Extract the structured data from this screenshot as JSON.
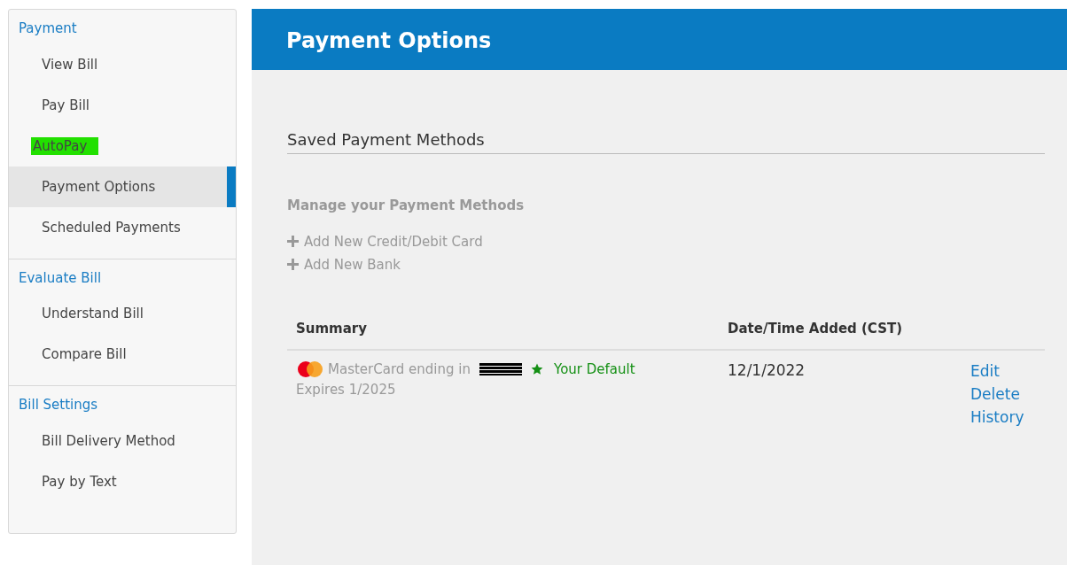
{
  "sidebar": {
    "sections": [
      {
        "heading": "Payment",
        "items": [
          {
            "label": "View Bill",
            "selected": false,
            "highlighted": false
          },
          {
            "label": "Pay Bill",
            "selected": false,
            "highlighted": false
          },
          {
            "label": "AutoPay",
            "selected": false,
            "highlighted": true
          },
          {
            "label": "Payment Options",
            "selected": true,
            "highlighted": false
          },
          {
            "label": "Scheduled Payments",
            "selected": false,
            "highlighted": false
          }
        ]
      },
      {
        "heading": "Evaluate Bill",
        "items": [
          {
            "label": "Understand Bill",
            "selected": false,
            "highlighted": false
          },
          {
            "label": "Compare Bill",
            "selected": false,
            "highlighted": false
          }
        ]
      },
      {
        "heading": "Bill Settings",
        "items": [
          {
            "label": "Bill Delivery Method",
            "selected": false,
            "highlighted": false
          },
          {
            "label": "Pay by Text",
            "selected": false,
            "highlighted": false
          }
        ]
      }
    ]
  },
  "page": {
    "title": "Payment Options",
    "section_title": "Saved Payment Methods",
    "manage_heading": "Manage your Payment Methods",
    "add_links": [
      "Add New Credit/Debit Card",
      "Add New Bank"
    ],
    "table": {
      "columns": [
        "Summary",
        "Date/Time Added (CST)"
      ],
      "rows": [
        {
          "card": "MasterCard ending in",
          "default": true,
          "default_label": "Your Default",
          "expires": "Expires 1/2025",
          "date": "12/1/2022",
          "actions": [
            "Edit",
            "Delete",
            "History"
          ]
        }
      ]
    }
  }
}
